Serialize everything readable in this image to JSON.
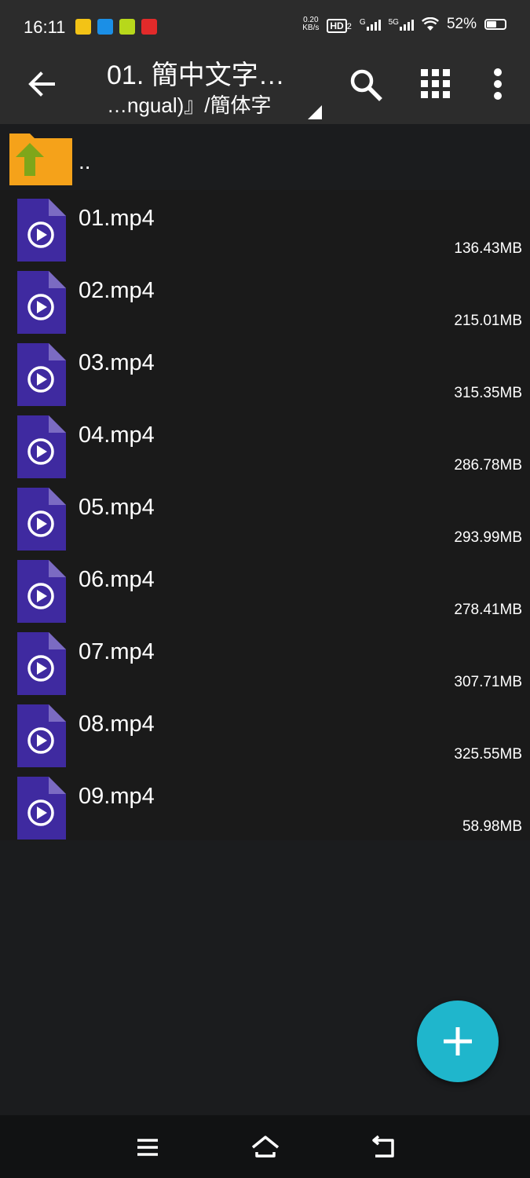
{
  "status_bar": {
    "time": "16:11",
    "speed_value": "0.20",
    "speed_unit": "KB/s",
    "hd": "HD",
    "hd_sub": "2",
    "net1": "G",
    "net2": "5G",
    "battery": "52%"
  },
  "appbar": {
    "title": "01. 簡中文字…",
    "subtitle": "…ngual)』/簡体字"
  },
  "parent_label": "..",
  "files": [
    {
      "name": "01.mp4",
      "size": "136.43MB"
    },
    {
      "name": "02.mp4",
      "size": "215.01MB"
    },
    {
      "name": "03.mp4",
      "size": "315.35MB"
    },
    {
      "name": "04.mp4",
      "size": "286.78MB"
    },
    {
      "name": "05.mp4",
      "size": "293.99MB"
    },
    {
      "name": "06.mp4",
      "size": "278.41MB"
    },
    {
      "name": "07.mp4",
      "size": "307.71MB"
    },
    {
      "name": "08.mp4",
      "size": "325.55MB"
    },
    {
      "name": "09.mp4",
      "size": "58.98MB"
    }
  ],
  "colors": {
    "file_icon": "#3f2aa0",
    "fab": "#1fb6cc",
    "folder": "#f5a21a",
    "folder_arrow": "#7fa61a"
  },
  "icons": [
    "back-arrow-icon",
    "search-icon",
    "grid-view-icon",
    "more-vert-icon",
    "folder-up-icon",
    "video-file-icon",
    "plus-icon",
    "menu-icon",
    "home-icon",
    "back-icon"
  ]
}
